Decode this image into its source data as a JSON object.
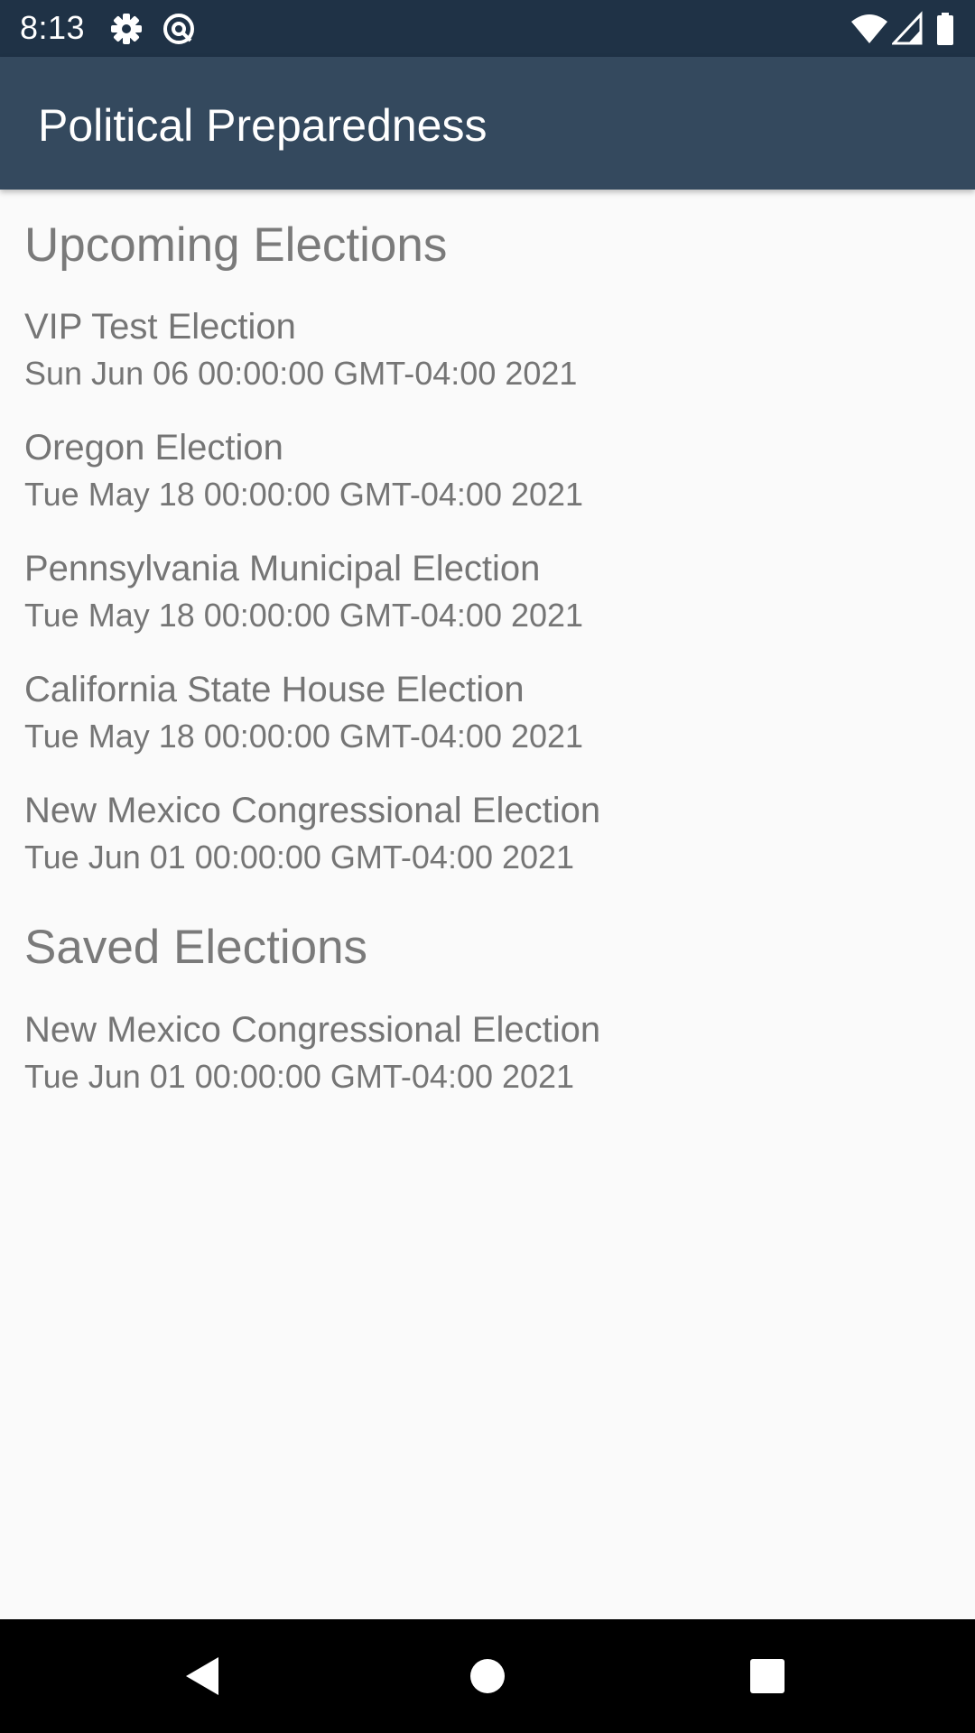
{
  "status_bar": {
    "time": "8:13",
    "icons": [
      "settings-icon",
      "app-notification-icon",
      "wifi-icon",
      "signal-icon",
      "battery-icon"
    ],
    "background": "#1f3246"
  },
  "app_bar": {
    "title": "Political Preparedness",
    "background": "#34495e"
  },
  "upcoming": {
    "header": "Upcoming Elections",
    "items": [
      {
        "name": "VIP Test Election",
        "date": "Sun Jun 06 00:00:00 GMT-04:00 2021"
      },
      {
        "name": "Oregon Election",
        "date": "Tue May 18 00:00:00 GMT-04:00 2021"
      },
      {
        "name": "Pennsylvania Municipal Election",
        "date": "Tue May 18 00:00:00 GMT-04:00 2021"
      },
      {
        "name": "California State House Election",
        "date": "Tue May 18 00:00:00 GMT-04:00 2021"
      },
      {
        "name": "New Mexico Congressional Election",
        "date": "Tue Jun 01 00:00:00 GMT-04:00 2021"
      }
    ]
  },
  "saved": {
    "header": "Saved Elections",
    "items": [
      {
        "name": "New Mexico Congressional Election",
        "date": "Tue Jun 01 00:00:00 GMT-04:00 2021"
      }
    ]
  },
  "nav_bar": {
    "buttons": [
      "back-icon",
      "home-icon",
      "recents-icon"
    ]
  }
}
